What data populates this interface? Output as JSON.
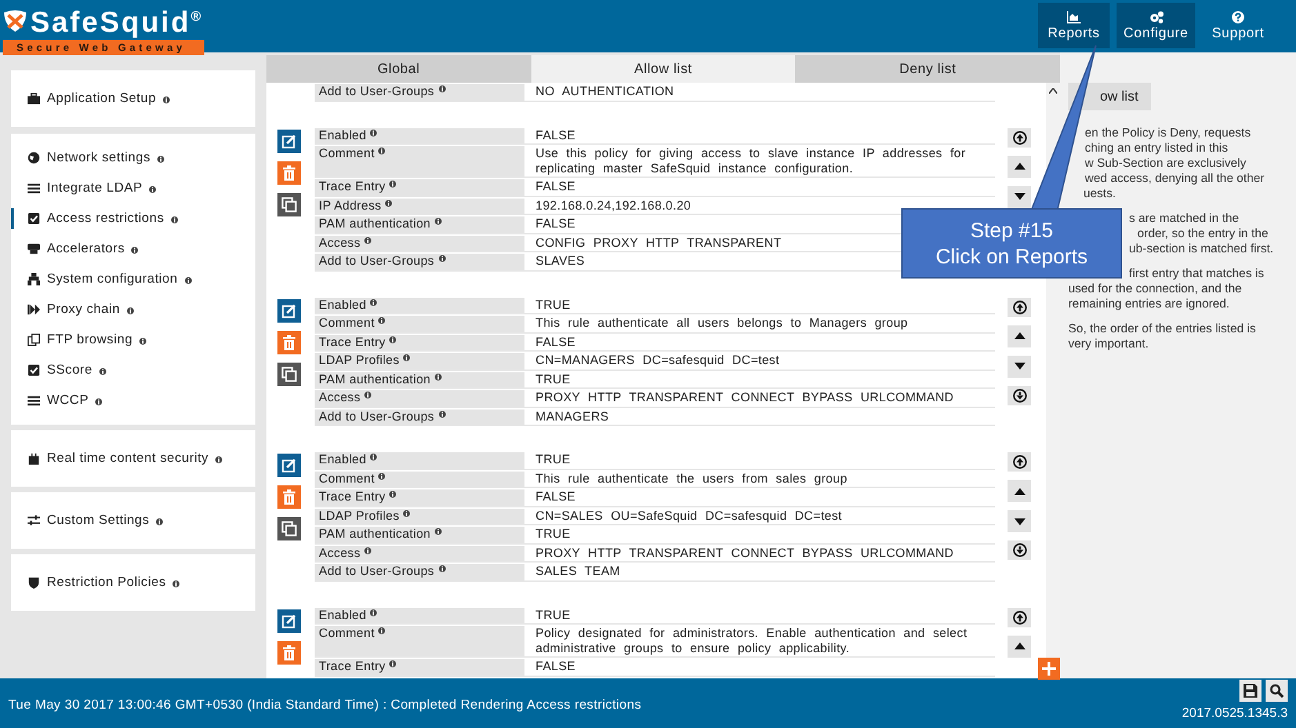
{
  "header": {
    "logo": {
      "name": "SafeSquid",
      "mark": "®",
      "tagline": "Secure Web Gateway"
    },
    "nav": [
      {
        "label": "Reports",
        "kind": "chart",
        "highlighted": true
      },
      {
        "label": "Configure",
        "kind": "gears",
        "highlighted": true
      },
      {
        "label": "Support",
        "kind": "help",
        "highlighted": false
      }
    ]
  },
  "sidebar": {
    "groups": [
      {
        "items": [
          {
            "label": "Application Setup",
            "kind": "briefcase",
            "selected": false
          }
        ]
      },
      {
        "items": [
          {
            "label": "Network settings",
            "kind": "globe",
            "selected": false
          },
          {
            "label": "Integrate LDAP",
            "kind": "bars",
            "selected": false
          },
          {
            "label": "Access restrictions",
            "kind": "check",
            "selected": true
          },
          {
            "label": "Accelerators",
            "kind": "drive",
            "selected": false
          },
          {
            "label": "System configuration",
            "kind": "sitemap",
            "selected": false
          },
          {
            "label": "Proxy chain",
            "kind": "forward",
            "selected": false
          },
          {
            "label": "FTP browsing",
            "kind": "copy",
            "selected": false
          },
          {
            "label": "SScore",
            "kind": "check",
            "selected": false
          },
          {
            "label": "WCCP",
            "kind": "bars",
            "selected": false
          }
        ]
      },
      {
        "items": [
          {
            "label": "Real time content security",
            "kind": "castle",
            "selected": false
          }
        ]
      },
      {
        "items": [
          {
            "label": "Custom Settings",
            "kind": "sliders",
            "selected": false
          }
        ]
      },
      {
        "items": [
          {
            "label": "Restriction Policies",
            "kind": "shield",
            "selected": false
          }
        ]
      }
    ]
  },
  "tabs": [
    {
      "label": "Global",
      "selected": false
    },
    {
      "label": "Allow list",
      "selected": true
    },
    {
      "label": "Deny list",
      "selected": false
    }
  ],
  "policies": [
    {
      "rows": [
        {
          "label": "Add to User-Groups",
          "value": "NO AUTHENTICATION"
        }
      ]
    },
    {
      "actions": [
        {
          "kind": "edit"
        },
        {
          "kind": "delete"
        },
        {
          "kind": "copy"
        }
      ],
      "moves": [
        {
          "kind": "top"
        },
        {
          "kind": "up"
        },
        {
          "kind": "down"
        }
      ],
      "rows": [
        {
          "label": "Enabled",
          "value": "FALSE"
        },
        {
          "label": "Comment",
          "value": "Use this policy for giving access to slave instance IP addresses for replicating master SafeSquid instance configuration."
        },
        {
          "label": "Trace Entry",
          "value": "FALSE"
        },
        {
          "label": "IP Address",
          "value": "192.168.0.24,192.168.0.20"
        },
        {
          "label": "PAM authentication",
          "value": "FALSE"
        },
        {
          "label": "Access",
          "value": "CONFIG PROXY HTTP TRANSPARENT"
        },
        {
          "label": "Add to User-Groups",
          "value": "SLAVES"
        }
      ]
    },
    {
      "actions": [
        {
          "kind": "edit"
        },
        {
          "kind": "delete"
        },
        {
          "kind": "copy"
        }
      ],
      "moves": [
        {
          "kind": "top"
        },
        {
          "kind": "up"
        },
        {
          "kind": "down"
        },
        {
          "kind": "bottom"
        }
      ],
      "rows": [
        {
          "label": "Enabled",
          "value": "TRUE"
        },
        {
          "label": "Comment",
          "value": "This rule authenticate all users belongs to Managers group"
        },
        {
          "label": "Trace Entry",
          "value": "FALSE"
        },
        {
          "label": "LDAP Profiles",
          "value": "CN=MANAGERS DC=safesquid DC=test"
        },
        {
          "label": "PAM authentication",
          "value": "TRUE"
        },
        {
          "label": "Access",
          "value": "PROXY HTTP TRANSPARENT CONNECT BYPASS URLCOMMAND"
        },
        {
          "label": "Add to User-Groups",
          "value": "MANAGERS"
        }
      ]
    },
    {
      "actions": [
        {
          "kind": "edit"
        },
        {
          "kind": "delete"
        },
        {
          "kind": "copy"
        }
      ],
      "moves": [
        {
          "kind": "top"
        },
        {
          "kind": "up"
        },
        {
          "kind": "down"
        },
        {
          "kind": "bottom"
        }
      ],
      "rows": [
        {
          "label": "Enabled",
          "value": "TRUE"
        },
        {
          "label": "Comment",
          "value": "This rule authenticate the users from sales group"
        },
        {
          "label": "Trace Entry",
          "value": "FALSE"
        },
        {
          "label": "LDAP Profiles",
          "value": "CN=SALES OU=SafeSquid DC=safesquid DC=test"
        },
        {
          "label": "PAM authentication",
          "value": "TRUE"
        },
        {
          "label": "Access",
          "value": "PROXY HTTP TRANSPARENT CONNECT BYPASS URLCOMMAND"
        },
        {
          "label": "Add to User-Groups",
          "value": "SALES TEAM"
        }
      ]
    },
    {
      "actions": [
        {
          "kind": "edit"
        },
        {
          "kind": "delete"
        }
      ],
      "moves": [
        {
          "kind": "top"
        },
        {
          "kind": "up"
        }
      ],
      "rows": [
        {
          "label": "Enabled",
          "value": "TRUE"
        },
        {
          "label": "Comment",
          "value": "Policy designated for administrators. Enable authentication and select administrative groups to ensure policy applicability."
        },
        {
          "label": "Trace Entry",
          "value": "FALSE"
        }
      ]
    }
  ],
  "help": {
    "button": "ow list",
    "paragraphs": [
      [
        "en the Policy is Deny, requests",
        "ching an entry listed in this",
        "w Sub-Section are exclusively",
        "wed access, denying all the other",
        "uests."
      ],
      [
        "s are matched in the",
        "order, so the entry in the",
        "ub-section is matched first."
      ],
      [
        "first entry that matches is",
        "used for the connection, and the",
        "remaining entries are ignored."
      ],
      [
        "So, the order of the entries listed is",
        "very important."
      ]
    ]
  },
  "callout": {
    "title": "Step #15",
    "text": "Click on Reports"
  },
  "status_bar": {
    "message": "Tue May 30 2017 13:00:46 GMT+0530 (India Standard Time) : Completed Rendering Access restrictions",
    "version": "2017.0525.1345.3"
  }
}
